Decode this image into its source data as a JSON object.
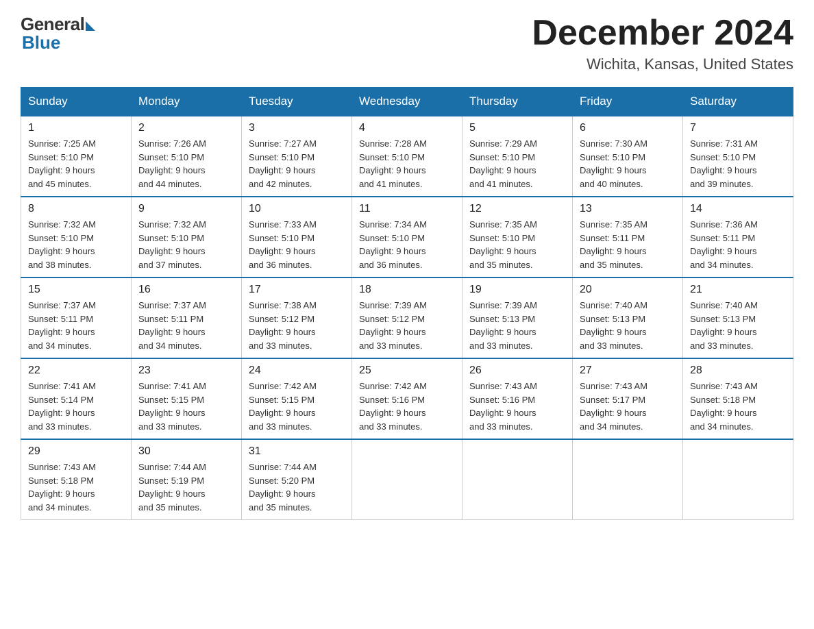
{
  "header": {
    "logo_general": "General",
    "logo_blue": "Blue",
    "month_title": "December 2024",
    "location": "Wichita, Kansas, United States"
  },
  "days_of_week": [
    "Sunday",
    "Monday",
    "Tuesday",
    "Wednesday",
    "Thursday",
    "Friday",
    "Saturday"
  ],
  "weeks": [
    [
      {
        "day": "1",
        "sunrise": "7:25 AM",
        "sunset": "5:10 PM",
        "daylight": "9 hours and 45 minutes."
      },
      {
        "day": "2",
        "sunrise": "7:26 AM",
        "sunset": "5:10 PM",
        "daylight": "9 hours and 44 minutes."
      },
      {
        "day": "3",
        "sunrise": "7:27 AM",
        "sunset": "5:10 PM",
        "daylight": "9 hours and 42 minutes."
      },
      {
        "day": "4",
        "sunrise": "7:28 AM",
        "sunset": "5:10 PM",
        "daylight": "9 hours and 41 minutes."
      },
      {
        "day": "5",
        "sunrise": "7:29 AM",
        "sunset": "5:10 PM",
        "daylight": "9 hours and 41 minutes."
      },
      {
        "day": "6",
        "sunrise": "7:30 AM",
        "sunset": "5:10 PM",
        "daylight": "9 hours and 40 minutes."
      },
      {
        "day": "7",
        "sunrise": "7:31 AM",
        "sunset": "5:10 PM",
        "daylight": "9 hours and 39 minutes."
      }
    ],
    [
      {
        "day": "8",
        "sunrise": "7:32 AM",
        "sunset": "5:10 PM",
        "daylight": "9 hours and 38 minutes."
      },
      {
        "day": "9",
        "sunrise": "7:32 AM",
        "sunset": "5:10 PM",
        "daylight": "9 hours and 37 minutes."
      },
      {
        "day": "10",
        "sunrise": "7:33 AM",
        "sunset": "5:10 PM",
        "daylight": "9 hours and 36 minutes."
      },
      {
        "day": "11",
        "sunrise": "7:34 AM",
        "sunset": "5:10 PM",
        "daylight": "9 hours and 36 minutes."
      },
      {
        "day": "12",
        "sunrise": "7:35 AM",
        "sunset": "5:10 PM",
        "daylight": "9 hours and 35 minutes."
      },
      {
        "day": "13",
        "sunrise": "7:35 AM",
        "sunset": "5:11 PM",
        "daylight": "9 hours and 35 minutes."
      },
      {
        "day": "14",
        "sunrise": "7:36 AM",
        "sunset": "5:11 PM",
        "daylight": "9 hours and 34 minutes."
      }
    ],
    [
      {
        "day": "15",
        "sunrise": "7:37 AM",
        "sunset": "5:11 PM",
        "daylight": "9 hours and 34 minutes."
      },
      {
        "day": "16",
        "sunrise": "7:37 AM",
        "sunset": "5:11 PM",
        "daylight": "9 hours and 34 minutes."
      },
      {
        "day": "17",
        "sunrise": "7:38 AM",
        "sunset": "5:12 PM",
        "daylight": "9 hours and 33 minutes."
      },
      {
        "day": "18",
        "sunrise": "7:39 AM",
        "sunset": "5:12 PM",
        "daylight": "9 hours and 33 minutes."
      },
      {
        "day": "19",
        "sunrise": "7:39 AM",
        "sunset": "5:13 PM",
        "daylight": "9 hours and 33 minutes."
      },
      {
        "day": "20",
        "sunrise": "7:40 AM",
        "sunset": "5:13 PM",
        "daylight": "9 hours and 33 minutes."
      },
      {
        "day": "21",
        "sunrise": "7:40 AM",
        "sunset": "5:13 PM",
        "daylight": "9 hours and 33 minutes."
      }
    ],
    [
      {
        "day": "22",
        "sunrise": "7:41 AM",
        "sunset": "5:14 PM",
        "daylight": "9 hours and 33 minutes."
      },
      {
        "day": "23",
        "sunrise": "7:41 AM",
        "sunset": "5:15 PM",
        "daylight": "9 hours and 33 minutes."
      },
      {
        "day": "24",
        "sunrise": "7:42 AM",
        "sunset": "5:15 PM",
        "daylight": "9 hours and 33 minutes."
      },
      {
        "day": "25",
        "sunrise": "7:42 AM",
        "sunset": "5:16 PM",
        "daylight": "9 hours and 33 minutes."
      },
      {
        "day": "26",
        "sunrise": "7:43 AM",
        "sunset": "5:16 PM",
        "daylight": "9 hours and 33 minutes."
      },
      {
        "day": "27",
        "sunrise": "7:43 AM",
        "sunset": "5:17 PM",
        "daylight": "9 hours and 34 minutes."
      },
      {
        "day": "28",
        "sunrise": "7:43 AM",
        "sunset": "5:18 PM",
        "daylight": "9 hours and 34 minutes."
      }
    ],
    [
      {
        "day": "29",
        "sunrise": "7:43 AM",
        "sunset": "5:18 PM",
        "daylight": "9 hours and 34 minutes."
      },
      {
        "day": "30",
        "sunrise": "7:44 AM",
        "sunset": "5:19 PM",
        "daylight": "9 hours and 35 minutes."
      },
      {
        "day": "31",
        "sunrise": "7:44 AM",
        "sunset": "5:20 PM",
        "daylight": "9 hours and 35 minutes."
      },
      null,
      null,
      null,
      null
    ]
  ],
  "labels": {
    "sunrise": "Sunrise:",
    "sunset": "Sunset:",
    "daylight": "Daylight:"
  }
}
